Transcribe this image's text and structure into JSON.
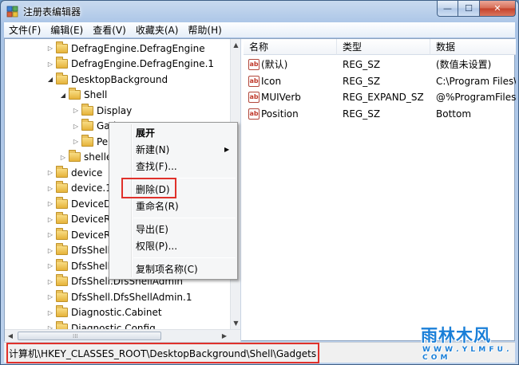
{
  "window": {
    "title": "注册表编辑器",
    "minimize_glyph": "—",
    "maximize_glyph": "☐",
    "close_glyph": "✕"
  },
  "menu": [
    "文件(F)",
    "编辑(E)",
    "查看(V)",
    "收藏夹(A)",
    "帮助(H)"
  ],
  "tree": {
    "items": [
      {
        "label": "DefragEngine.DefragEngine",
        "indent": 4,
        "open": false
      },
      {
        "label": "DefragEngine.DefragEngine.1",
        "indent": 4,
        "open": false
      },
      {
        "label": "DesktopBackground",
        "indent": 4,
        "open": true
      },
      {
        "label": "Shell",
        "indent": 5,
        "open": true
      },
      {
        "label": "Display",
        "indent": 6,
        "open": false
      },
      {
        "label": "Gadgets",
        "indent": 6,
        "open": false
      },
      {
        "label": "Personalize",
        "indent": 6,
        "open": false
      },
      {
        "label": "shellex",
        "indent": 5,
        "open": false
      },
      {
        "label": "device",
        "indent": 4,
        "open": false
      },
      {
        "label": "device.1",
        "indent": 4,
        "open": false
      },
      {
        "label": "DeviceDisplayObject",
        "indent": 4,
        "open": false
      },
      {
        "label": "DeviceRect",
        "indent": 4,
        "open": false
      },
      {
        "label": "DeviceRect.1",
        "indent": 4,
        "open": false
      },
      {
        "label": "DfsShell.DfsShell",
        "indent": 4,
        "open": false
      },
      {
        "label": "DfsShell.DfsShell.1",
        "indent": 4,
        "open": false
      },
      {
        "label": "DfsShell.DfsShellAdmin",
        "indent": 4,
        "open": false
      },
      {
        "label": "DfsShell.DfsShellAdmin.1",
        "indent": 4,
        "open": false
      },
      {
        "label": "Diagnostic.Cabinet",
        "indent": 4,
        "open": false
      },
      {
        "label": "Diagnostic.Config",
        "indent": 4,
        "open": false
      }
    ]
  },
  "list": {
    "headers": [
      "名称",
      "类型",
      "数据"
    ],
    "rows": [
      {
        "name": "(默认)",
        "type": "REG_SZ",
        "data": "(数值未设置)"
      },
      {
        "name": "Icon",
        "type": "REG_SZ",
        "data": "C:\\Program Files\\Windows Sidebar\\sidebar.exe"
      },
      {
        "name": "MUIVerb",
        "type": "REG_EXPAND_SZ",
        "data": "@%ProgramFiles%\\Windows Sidebar\\sidebar.exe"
      },
      {
        "name": "Position",
        "type": "REG_SZ",
        "data": "Bottom"
      }
    ],
    "value_icon_text": "ab"
  },
  "context_menu": {
    "items": [
      "展开",
      "新建(N)",
      "查找(F)...",
      "删除(D)",
      "重命名(R)",
      "导出(E)",
      "权限(P)...",
      "复制项名称(C)"
    ],
    "submenu_arrow": "▶"
  },
  "status": {
    "path": "计算机\\HKEY_CLASSES_ROOT\\DesktopBackground\\Shell\\Gadgets"
  },
  "watermark": {
    "text": "雨林木风",
    "url": "W W W . Y L M F U . C O M"
  },
  "colors": {
    "highlight_box": "#e0312b",
    "watermark": "#1a7fd8"
  }
}
